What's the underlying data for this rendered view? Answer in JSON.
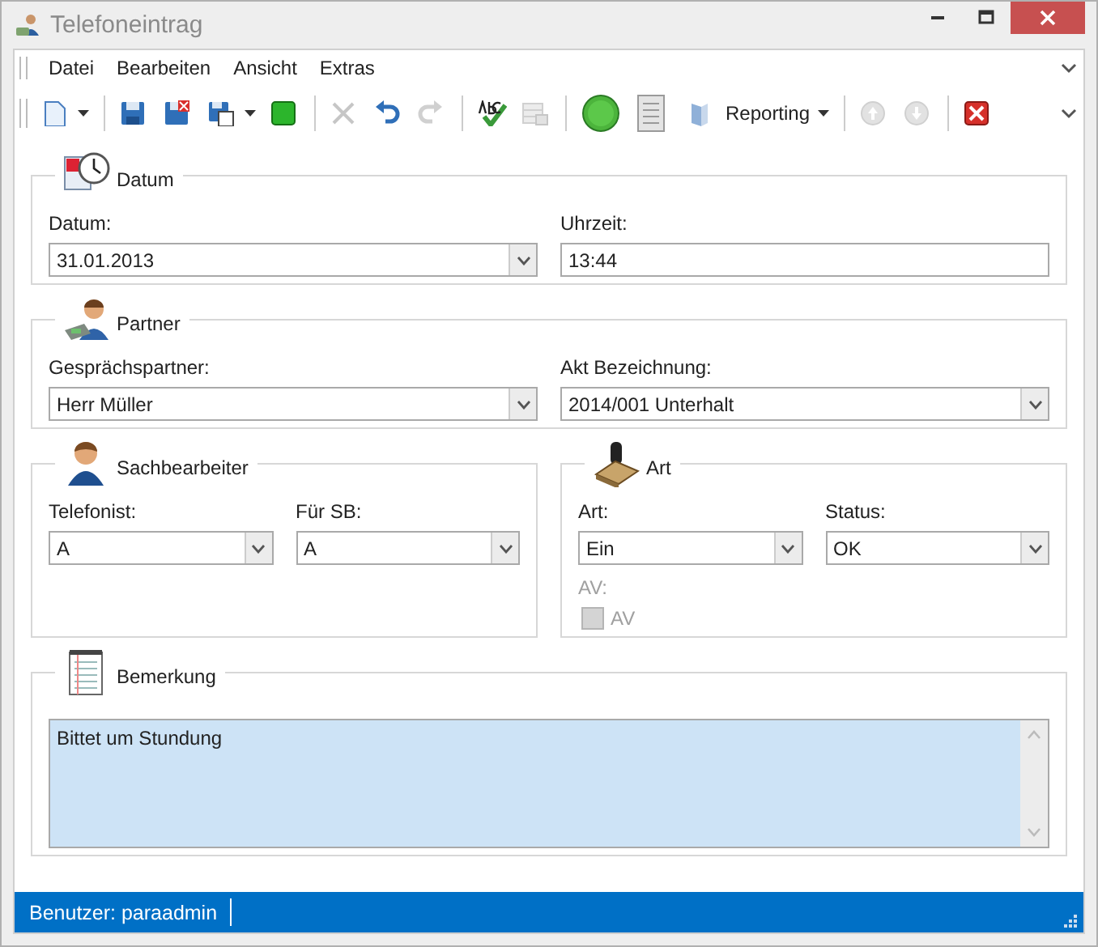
{
  "window": {
    "title": "Telefoneintrag"
  },
  "menu": [
    "Datei",
    "Bearbeiten",
    "Ansicht",
    "Extras"
  ],
  "toolbar": [
    {
      "kind": "button",
      "disabled": false,
      "dropdown": true
    },
    {
      "kind": "separator"
    },
    {
      "kind": "button",
      "disabled": false,
      "dropdown": false
    },
    {
      "kind": "button",
      "disabled": false,
      "dropdown": false
    },
    {
      "kind": "button",
      "disabled": false,
      "dropdown": true
    },
    {
      "kind": "button",
      "disabled": false,
      "dropdown": false
    },
    {
      "kind": "separator"
    },
    {
      "kind": "button",
      "disabled": true,
      "dropdown": false
    },
    {
      "kind": "button",
      "disabled": false,
      "dropdown": false
    },
    {
      "kind": "button",
      "disabled": true,
      "dropdown": false
    },
    {
      "kind": "separator"
    },
    {
      "kind": "button",
      "disabled": false,
      "dropdown": false
    },
    {
      "kind": "button",
      "disabled": true,
      "dropdown": false
    },
    {
      "kind": "separator"
    },
    {
      "kind": "button",
      "disabled": false,
      "dropdown": false
    },
    {
      "kind": "button",
      "disabled": false,
      "dropdown": false
    },
    {
      "kind": "button",
      "disabled": false,
      "dropdown": true,
      "label": "Reporting"
    },
    {
      "kind": "separator"
    },
    {
      "kind": "button",
      "disabled": true,
      "dropdown": false
    },
    {
      "kind": "button",
      "disabled": true,
      "dropdown": false
    },
    {
      "kind": "separator"
    },
    {
      "kind": "button",
      "disabled": false,
      "dropdown": false
    }
  ],
  "rows": [
    [
      {
        "title": "Datum",
        "fields": [
          {
            "kind": "combo",
            "label": "Datum:",
            "value": "31.01.2013"
          },
          {
            "kind": "text",
            "label": "Uhrzeit:",
            "value": "13:44"
          }
        ]
      }
    ],
    [
      {
        "title": "Partner",
        "fields": [
          {
            "kind": "combo",
            "label": "Gesprächspartner:",
            "value": "Herr Müller"
          },
          {
            "kind": "combo",
            "label": "Akt Bezeichnung:",
            "value": "2014/001 Unterhalt"
          }
        ]
      }
    ],
    [
      {
        "title": "Sachbearbeiter",
        "fields": [
          {
            "kind": "combo",
            "label": "Telefonist:",
            "value": "A"
          },
          {
            "kind": "combo",
            "label": "Für SB:",
            "value": "A"
          }
        ]
      },
      {
        "title": "Art",
        "fields": [
          {
            "kind": "combo",
            "label": "Art:",
            "value": "Ein"
          },
          {
            "kind": "combo",
            "label": "Status:",
            "value": "OK"
          },
          {
            "kind": "checkbox",
            "label": "AV:",
            "caption": "AV",
            "checked": false,
            "disabled": true
          }
        ]
      }
    ],
    [
      {
        "title": "Bemerkung",
        "fields": [
          {
            "kind": "memo",
            "value": "Bittet um Stundung"
          }
        ]
      }
    ]
  ],
  "status_bar": {
    "text": "Benutzer: paraadmin"
  }
}
